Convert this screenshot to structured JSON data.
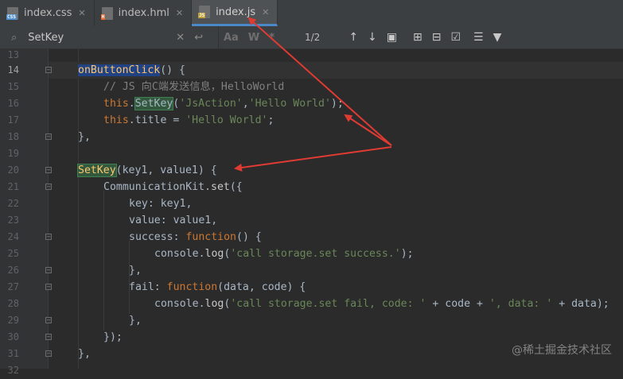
{
  "tabs": [
    {
      "label": "index.css",
      "icon": "css-file-icon",
      "badge": "CSS",
      "badge_color": "#4f8fcd"
    },
    {
      "label": "index.hml",
      "icon": "html-file-icon",
      "badge": "H",
      "badge_color": "#e8682f"
    },
    {
      "label": "index.js",
      "icon": "js-file-icon",
      "badge": "JS",
      "badge_color": "#c0a03a",
      "active": true
    }
  ],
  "find": {
    "query": "SetKey",
    "match_count": "1/2",
    "match_case_label": "Aa",
    "words_label": "W",
    "regex_label": "*"
  },
  "lines": [
    {
      "num": "13"
    },
    {
      "num": "14"
    },
    {
      "num": "15"
    },
    {
      "num": "16"
    },
    {
      "num": "17"
    },
    {
      "num": "18"
    },
    {
      "num": "19"
    },
    {
      "num": "20"
    },
    {
      "num": "21"
    },
    {
      "num": "22"
    },
    {
      "num": "23"
    },
    {
      "num": "24"
    },
    {
      "num": "25"
    },
    {
      "num": "26"
    },
    {
      "num": "27"
    },
    {
      "num": "28"
    },
    {
      "num": "29"
    },
    {
      "num": "30"
    },
    {
      "num": "31"
    },
    {
      "num": "32"
    }
  ],
  "code": {
    "l14_fn": "onButtonClick",
    "l14_rest": "() {",
    "l15_comment": "// JS 向C端发送信息，HelloWorld",
    "l16_this": "this",
    "l16_dot": ".",
    "l16_call": "SetKey",
    "l16_open": "(",
    "l16_s1": "'JsAction'",
    "l16_comma": ",",
    "l16_s2": "'Hello World'",
    "l16_close": ");",
    "l17_this": "this",
    "l17_prop": ".title = ",
    "l17_str": "'Hello World'",
    "l17_end": ";",
    "l18": "},",
    "l20_fn": "SetKey",
    "l20_rest": "(key1, value1) {",
    "l21_obj": "CommunicationKit",
    "l21_dot": ".",
    "l21_method": "set",
    "l21_rest": "({",
    "l22": "key: key1,",
    "l23": "value: value1,",
    "l24_key": "success: ",
    "l24_kw": "function",
    "l24_rest": "() {",
    "l25_obj": "console",
    "l25_dot": ".",
    "l25_method": "log",
    "l25_open": "(",
    "l25_str": "'call storage.set success.'",
    "l25_close": ");",
    "l26": "},",
    "l27_key": "fail: ",
    "l27_kw": "function",
    "l27_rest": "(data, code) {",
    "l28_obj": "console",
    "l28_dot": ".",
    "l28_method": "log",
    "l28_open": "(",
    "l28_s1": "'call storage.set fail, code: '",
    "l28_mid": " + code + ",
    "l28_s2": "', data: '",
    "l28_end": " + data);",
    "l29": "},",
    "l30": "});",
    "l31": "},"
  },
  "watermark": "@稀土掘金技术社区",
  "colors": {
    "accent": "#4a88c7",
    "arrow": "#e03b33",
    "keyword": "#cc7832",
    "string": "#6a8759",
    "comment": "#808080"
  }
}
